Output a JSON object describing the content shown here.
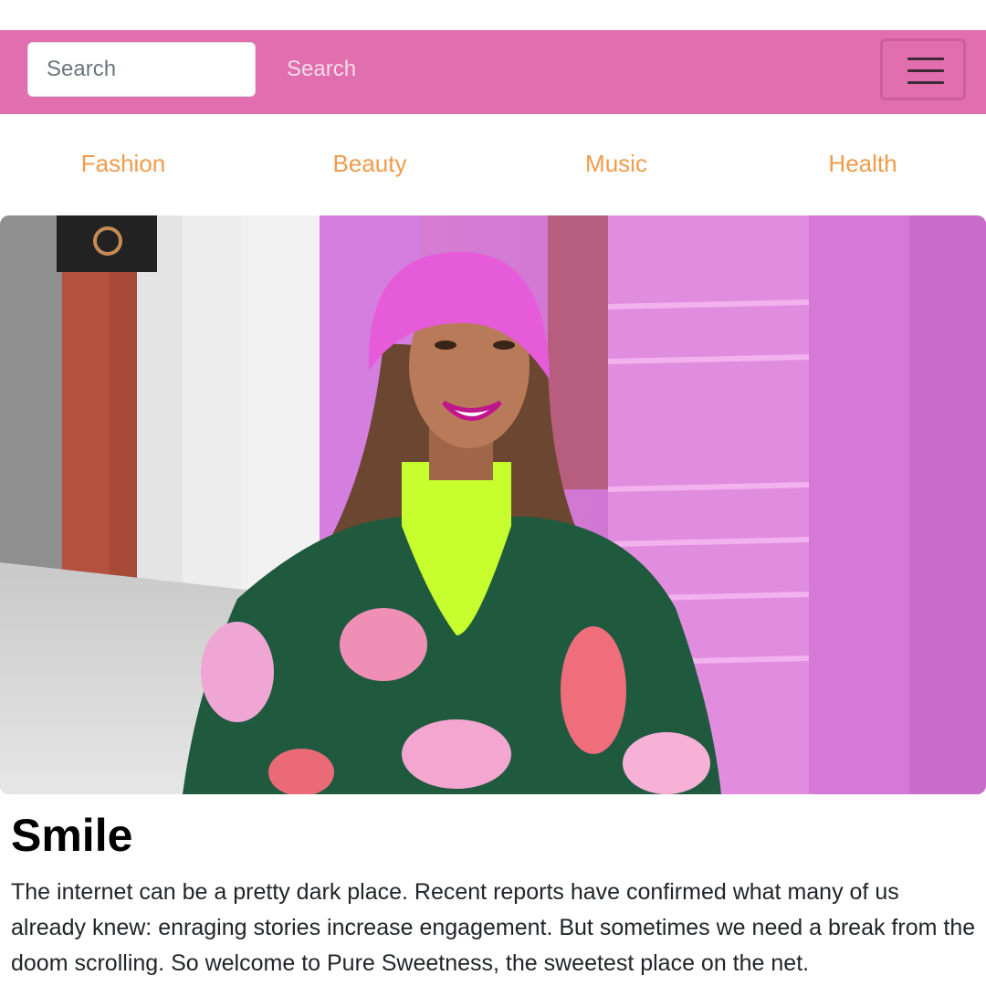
{
  "navbar": {
    "search_placeholder": "Search",
    "search_button_label": "Search",
    "menu_icon": "hamburger-menu-icon",
    "background_color": "#e16faf"
  },
  "categories": [
    {
      "label": "Fashion"
    },
    {
      "label": "Beauty"
    },
    {
      "label": "Music"
    },
    {
      "label": "Health"
    }
  ],
  "article": {
    "title": "Smile",
    "body": "The internet can be a pretty dark place. Recent reports have confirmed what many of us already knew: enraging stories increase engagement. But sometimes we need a break from the doom scrolling. So welcome to Pure Sweetness, the sweetest place on the net."
  },
  "colors": {
    "accent": "#f29b4a",
    "brand_pink": "#e16faf"
  }
}
